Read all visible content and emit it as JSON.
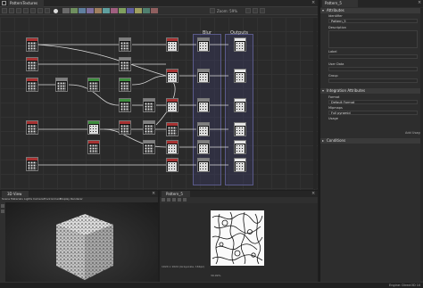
{
  "window": {
    "tab_title": "PatternTextures",
    "zoom_label": "Zoom: 59%"
  },
  "graph": {
    "frame_blur_title": "Blur",
    "frame_outputs_title": "Outputs"
  },
  "properties": {
    "tab_title": "Pattern_5",
    "section_attributes": "Attributes",
    "identifier_label": "Identifier",
    "identifier_value": "Pattern_5",
    "description_label": "Description",
    "label_label": "Label",
    "user_data_label": "User Data",
    "group_label": "Group",
    "section_integration": "Integration Attributes",
    "format_label": "Format",
    "format_value": "Default Format",
    "mipmaps_label": "Mipmaps",
    "mipmaps_value": "Full pyramid",
    "usage_label": "Usage",
    "add_usage": "Add Usage",
    "section_conditions": "Conditions"
  },
  "view3d": {
    "tab_title": "3D View",
    "menus": [
      "Scene",
      "Materials",
      "Lights",
      "Camera",
      "Environment",
      "Display",
      "Renderer"
    ]
  },
  "view2d": {
    "tab_title": "Pattern_5",
    "status": "1024 x 1024 (Grayscale, 16bpc)",
    "zoom": "39.99%"
  },
  "status_bar": {
    "engine": "Engine: Direct3D 10"
  },
  "swatch_colors": [
    "#6a6a6a",
    "#6f8f5f",
    "#5f7f9f",
    "#7f6f9f",
    "#9f7f5f",
    "#5f9f9f",
    "#9f5f7f",
    "#7f9f5f",
    "#5f5f9f",
    "#9f9f5f",
    "#4f7f6f",
    "#8f5f5f"
  ],
  "node_header_colors": {
    "red": "#a83232",
    "green": "#3e8e3e",
    "gray": "#808080",
    "white": "#e6e6e6"
  }
}
